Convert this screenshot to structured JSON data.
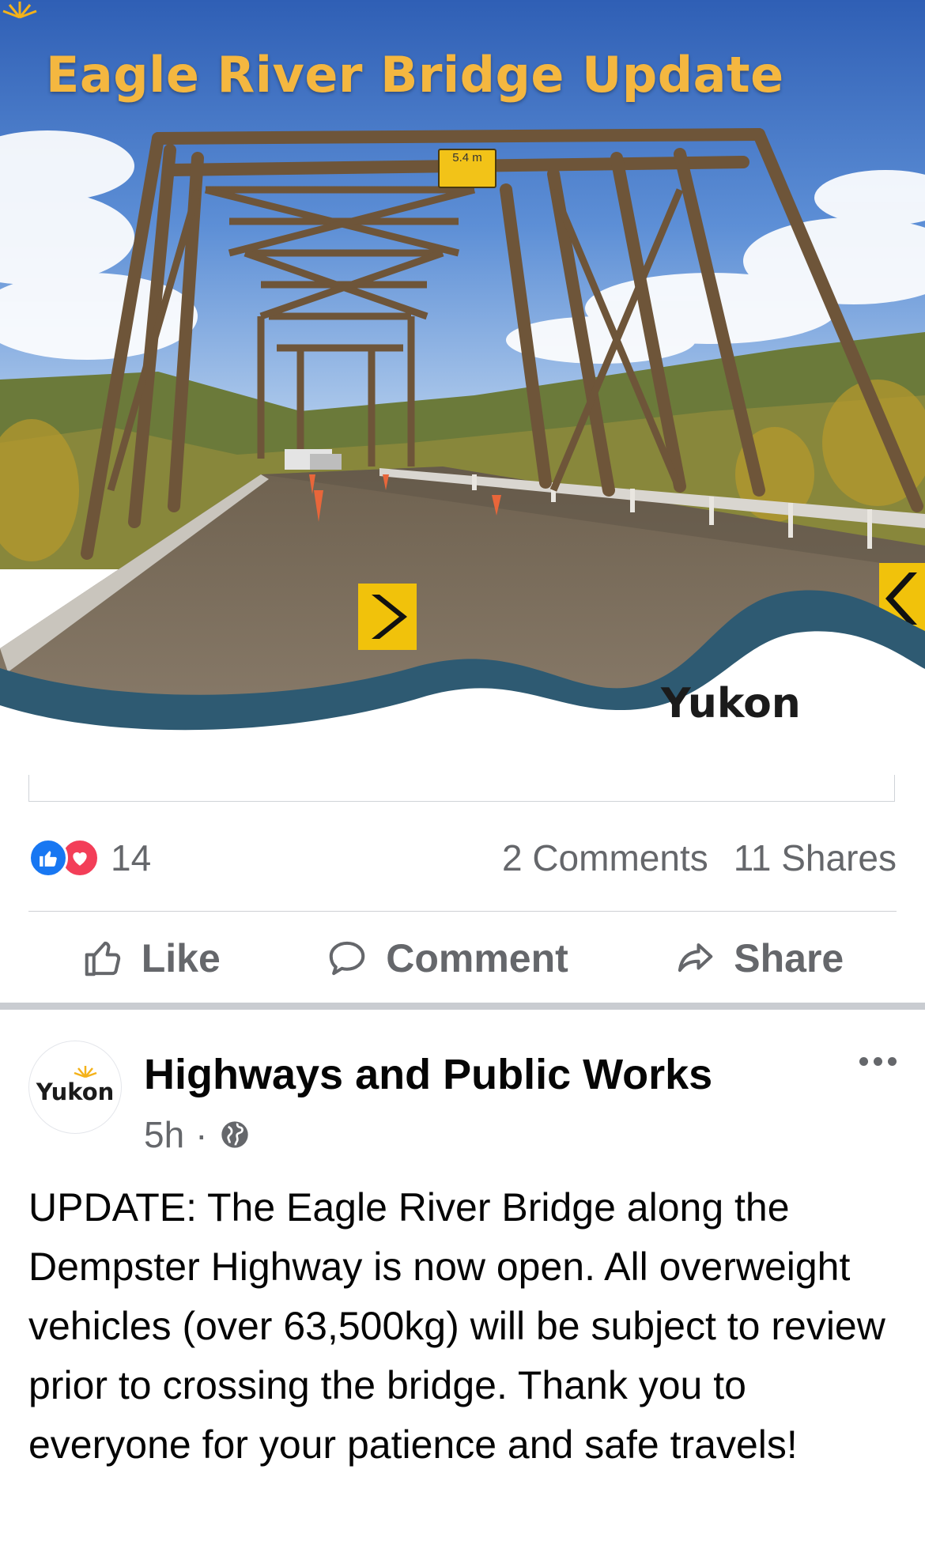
{
  "hero": {
    "title": "Eagle River Bridge Update",
    "clearance_sign": "5.4 m",
    "brand": "Yukon"
  },
  "reactions": {
    "count": "14",
    "comments": "2 Comments",
    "shares": "11 Shares",
    "icons": [
      "like-icon",
      "love-icon"
    ],
    "colors": {
      "like": "#1877f2",
      "love": "#f33e58"
    }
  },
  "actions": {
    "like_label": "Like",
    "comment_label": "Comment",
    "share_label": "Share"
  },
  "post": {
    "avatar_text": "Yukon",
    "page_name": "Highways and Public Works",
    "time": "5h",
    "separator": "·",
    "audience_icon": "globe-icon",
    "body": "UPDATE: The Eagle River Bridge along the Dempster Highway is now open. All overweight vehicles (over 63,500kg) will be subject to review prior to crossing the bridge. Thank you to everyone for your patience and safe travels!"
  }
}
